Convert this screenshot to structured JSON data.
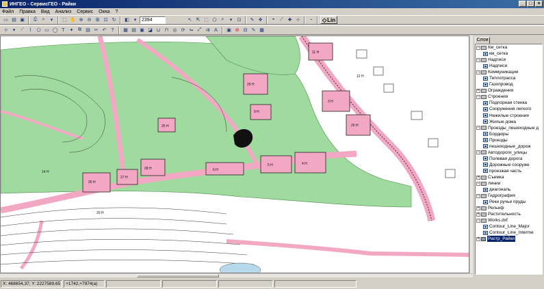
{
  "window": {
    "title": "ИНГЕО - СервисГЕО - Райки",
    "buttons": [
      "_",
      "□",
      "×"
    ]
  },
  "menu": [
    "Файл",
    "Правка",
    "Вид",
    "Анализ",
    "Сервис",
    "Окна",
    "?"
  ],
  "toolbar1": {
    "scale_value": "2394",
    "lin_label": "Lin"
  },
  "layers_panel": {
    "tab_label": "Слои",
    "tree": [
      {
        "label": "Км_сетка",
        "level": 0,
        "kind": "group",
        "expanded": true
      },
      {
        "label": "км_сетка",
        "level": 1,
        "kind": "layer"
      },
      {
        "label": "Надписи",
        "level": 0,
        "kind": "group",
        "expanded": true
      },
      {
        "label": "Надписи",
        "level": 1,
        "kind": "layer"
      },
      {
        "label": "Коммуникации",
        "level": 0,
        "kind": "group",
        "expanded": true
      },
      {
        "label": "Теплотрасса",
        "level": 1,
        "kind": "layer"
      },
      {
        "label": "Газопровод",
        "level": 1,
        "kind": "layer"
      },
      {
        "label": "Ограждения",
        "level": 0,
        "kind": "group",
        "expanded": false
      },
      {
        "label": "Строения",
        "level": 0,
        "kind": "group",
        "expanded": true
      },
      {
        "label": "Подпорная стенка",
        "level": 1,
        "kind": "layer"
      },
      {
        "label": "Сооружения легкого",
        "level": 1,
        "kind": "layer"
      },
      {
        "label": "Нежилые строения",
        "level": 1,
        "kind": "layer"
      },
      {
        "label": "Жилые дома",
        "level": 1,
        "kind": "layer"
      },
      {
        "label": "Проезды_пешеходные д",
        "level": 0,
        "kind": "group",
        "expanded": true
      },
      {
        "label": "Бордюры",
        "level": 1,
        "kind": "layer"
      },
      {
        "label": "Проезды",
        "level": 1,
        "kind": "layer"
      },
      {
        "label": "пешеходные_дорож",
        "level": 1,
        "kind": "layer"
      },
      {
        "label": "Автодороги_улицы",
        "level": 0,
        "kind": "group",
        "expanded": true
      },
      {
        "label": "Полевая дорога",
        "level": 1,
        "kind": "layer"
      },
      {
        "label": "Дорожные сооруже",
        "level": 1,
        "kind": "layer"
      },
      {
        "label": "проезжая часть",
        "level": 1,
        "kind": "layer"
      },
      {
        "label": "Съемка",
        "level": 0,
        "kind": "group",
        "expanded": false
      },
      {
        "label": "линии",
        "level": 0,
        "kind": "group",
        "expanded": true
      },
      {
        "label": "диагональ",
        "level": 1,
        "kind": "layer"
      },
      {
        "label": "Гидрография",
        "level": 0,
        "kind": "group",
        "expanded": true
      },
      {
        "label": "Реки ручьи пруды",
        "level": 1,
        "kind": "layer"
      },
      {
        "label": "Рельеф",
        "level": 0,
        "kind": "group",
        "expanded": false
      },
      {
        "label": "Растительность",
        "level": 0,
        "kind": "group",
        "expanded": false
      },
      {
        "label": "Works.dxf",
        "level": 0,
        "kind": "group",
        "expanded": true
      },
      {
        "label": "Contour_Line_Major",
        "level": 1,
        "kind": "layer"
      },
      {
        "label": "Contour_Line_Interme",
        "level": 1,
        "kind": "layer"
      },
      {
        "label": "Растр_Райки",
        "level": 0,
        "kind": "raster",
        "selected": true
      }
    ]
  },
  "statusbar": {
    "coords": "X: 468654,37; Y: 2227589,65",
    "offset": "+1742,+7974(a)",
    "cells": [
      "",
      "",
      "",
      ""
    ]
  },
  "map": {
    "colors": {
      "green": "#9fdb9f",
      "pink": "#f2a7c3",
      "road": "#f5c6d8",
      "lines": "#222222",
      "water": "#b8d8ec"
    },
    "labels": [
      "26 Н",
      "27 Н",
      "28 Н",
      "29 Н",
      "9 Н",
      "6 Н",
      "5 Н",
      "4 Н",
      "3 Н",
      "20 Н",
      "11 Н",
      "25 Н",
      "20 Н",
      "14 Н",
      "12 Н"
    ]
  }
}
